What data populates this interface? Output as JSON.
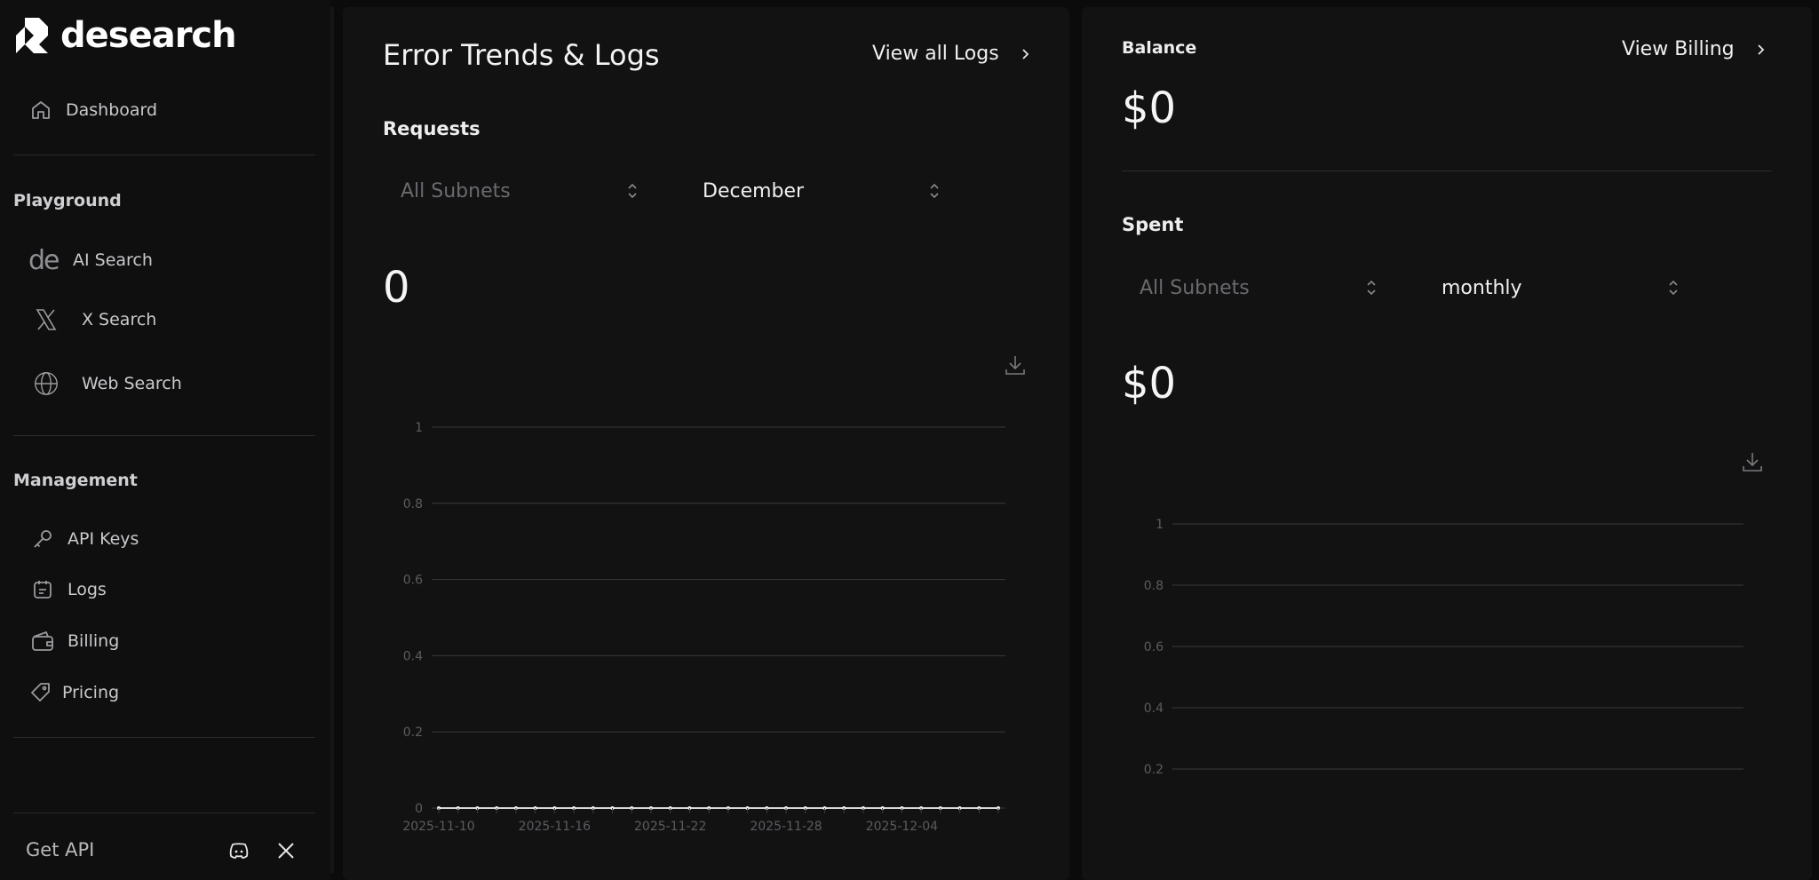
{
  "brand": {
    "name": "desearch"
  },
  "sidebar": {
    "dashboard": {
      "label": "Dashboard",
      "icon": "home-icon"
    },
    "playground_title": "Playground",
    "playground": [
      {
        "label": "AI Search",
        "icon": "de-logo-icon"
      },
      {
        "label": "X Search",
        "icon": "x-logo-icon"
      },
      {
        "label": "Web Search",
        "icon": "globe-icon"
      }
    ],
    "management_title": "Management",
    "management": [
      {
        "label": "API Keys",
        "icon": "key-icon"
      },
      {
        "label": "Logs",
        "icon": "calendar-list-icon"
      },
      {
        "label": "Billing",
        "icon": "wallet-icon"
      },
      {
        "label": "Pricing",
        "icon": "tag-icon"
      }
    ],
    "get_api": "Get API",
    "social": [
      "discord-icon",
      "x-logo-icon"
    ]
  },
  "left_panel": {
    "title": "Error Trends & Logs",
    "view_all": "View all Logs",
    "requests_label": "Requests",
    "subnet_select": {
      "value": "All Subnets",
      "placeholder": true
    },
    "month_select": {
      "value": "December"
    },
    "total": "0"
  },
  "right_panel": {
    "balance_label": "Balance",
    "balance_value": "$0",
    "view_billing": "View Billing",
    "spent_label": "Spent",
    "subnet_select": {
      "value": "All Subnets",
      "placeholder": true
    },
    "period_select": {
      "value": "monthly"
    },
    "spent_value": "$0"
  },
  "colors": {
    "background": "#0b0b0c",
    "panel": "#121213",
    "gridline": "#3a3a3d",
    "tick_text": "#5c5c60",
    "placeholder_text": "#6a6a6e"
  },
  "chart_data": [
    {
      "type": "line",
      "yticks": [
        "0",
        "0.2",
        "0.4",
        "0.6",
        "0.8",
        "1"
      ],
      "ylim": [
        0,
        1
      ],
      "x": [
        "2025-11-10",
        "2025-11-11",
        "2025-11-12",
        "2025-11-13",
        "2025-11-14",
        "2025-11-15",
        "2025-11-16",
        "2025-11-17",
        "2025-11-18",
        "2025-11-19",
        "2025-11-20",
        "2025-11-21",
        "2025-11-22",
        "2025-11-23",
        "2025-11-24",
        "2025-11-25",
        "2025-11-26",
        "2025-11-27",
        "2025-11-28",
        "2025-11-29",
        "2025-11-30",
        "2025-12-01",
        "2025-12-02",
        "2025-12-03",
        "2025-12-04",
        "2025-12-05",
        "2025-12-06",
        "2025-12-07",
        "2025-12-08",
        "2025-12-09"
      ],
      "xtick_labels": [
        "2025-11-10",
        "2025-11-16",
        "2025-11-22",
        "2025-11-28",
        "2025-12-04"
      ],
      "values": [
        0,
        0,
        0,
        0,
        0,
        0,
        0,
        0,
        0,
        0,
        0,
        0,
        0,
        0,
        0,
        0,
        0,
        0,
        0,
        0,
        0,
        0,
        0,
        0,
        0,
        0,
        0,
        0,
        0,
        0
      ],
      "grid": true
    },
    {
      "type": "line",
      "yticks": [
        "0.2",
        "0.4",
        "0.6",
        "0.8",
        "1"
      ],
      "ylim": [
        0,
        1
      ],
      "values": [],
      "grid": true
    }
  ]
}
